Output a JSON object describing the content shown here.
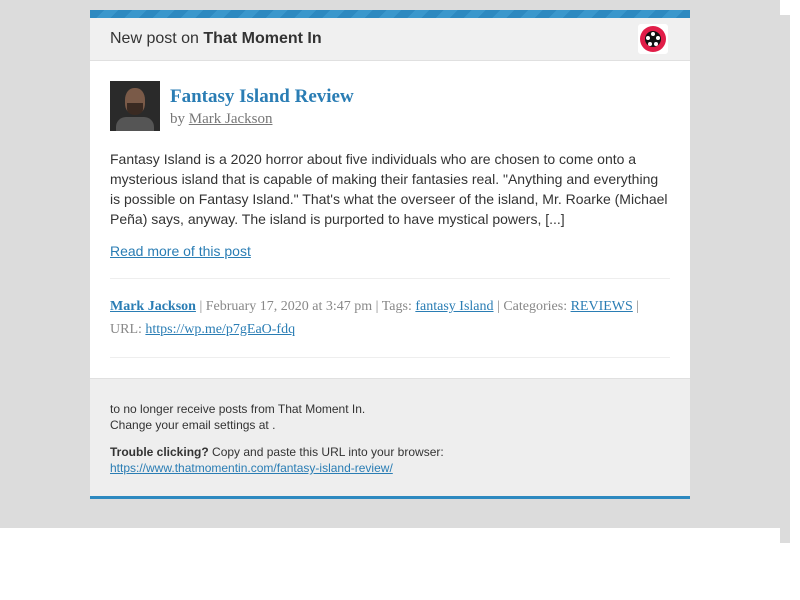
{
  "header": {
    "prefix": "New post on",
    "site_name": "That Moment In"
  },
  "post": {
    "title": "Fantasy Island Review",
    "by_label": "by",
    "author": "Mark Jackson",
    "excerpt": "Fantasy Island is a 2020 horror about five individuals who are chosen to come onto a mysterious island that is capable of making their fantasies real. \"Anything and everything is possible on Fantasy Island.\" That's what the overseer of the island, Mr. Roarke (Michael Peña) says, anyway. The island is purported to have mystical powers, [...]",
    "read_more": "Read more of this post"
  },
  "meta": {
    "author": "Mark Jackson",
    "date": "| February 17, 2020 at 3:47 pm | Tags:",
    "tag": "fantasy Island",
    "categories_label": "| Categories:",
    "category": "REVIEWS",
    "url_label": "| URL:",
    "short_url": "https://wp.me/p7gEaO-fdq"
  },
  "footer": {
    "unsubscribe_line": "to no longer receive posts from That Moment In.",
    "settings_line": "Change your email settings at .",
    "trouble_label": "Trouble clicking?",
    "trouble_text": "Copy and paste this URL into your browser:",
    "full_url": "https://www.thatmomentin.com/fantasy-island-review/"
  },
  "colors": {
    "accent": "#2a7db4",
    "stripe": "#2d89c0",
    "background": "#dcdcdc",
    "site_icon": "#e11d48"
  },
  "icons": {
    "site_icon": "film-reel-icon"
  }
}
